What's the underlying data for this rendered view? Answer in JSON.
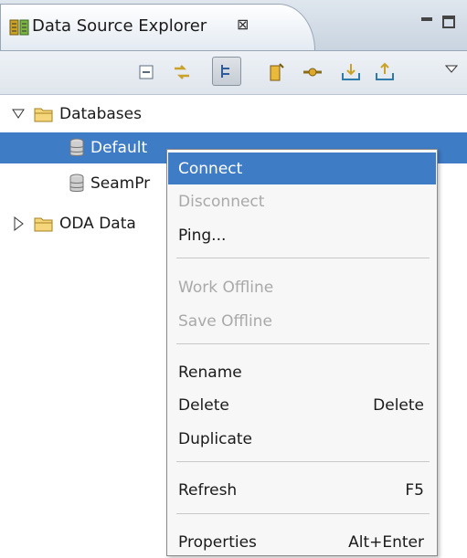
{
  "view": {
    "title": "Data Source Explorer",
    "close_symbol": "⊠"
  },
  "toolbar": {
    "buttons": [
      {
        "icon": "collapse-all-icon"
      },
      {
        "icon": "link-with-editor-icon"
      },
      {
        "icon": "filter-icon",
        "pressed": true
      },
      {
        "icon": "new-connection-icon"
      },
      {
        "icon": "connect-icon"
      },
      {
        "icon": "import-icon"
      },
      {
        "icon": "export-icon"
      },
      {
        "icon": "view-menu-icon"
      }
    ]
  },
  "tree": {
    "databases_label": "Databases",
    "default_label": "Default",
    "seam_label": "SeamPr",
    "oda_label": "ODA Data"
  },
  "context_menu": {
    "connect": "Connect",
    "disconnect": "Disconnect",
    "ping": "Ping...",
    "work_offline": "Work Offline",
    "save_offline": "Save Offline",
    "rename": "Rename",
    "delete": "Delete",
    "delete_shortcut": "Delete",
    "duplicate": "Duplicate",
    "refresh": "Refresh",
    "refresh_shortcut": "F5",
    "properties": "Properties",
    "properties_shortcut": "Alt+Enter"
  }
}
